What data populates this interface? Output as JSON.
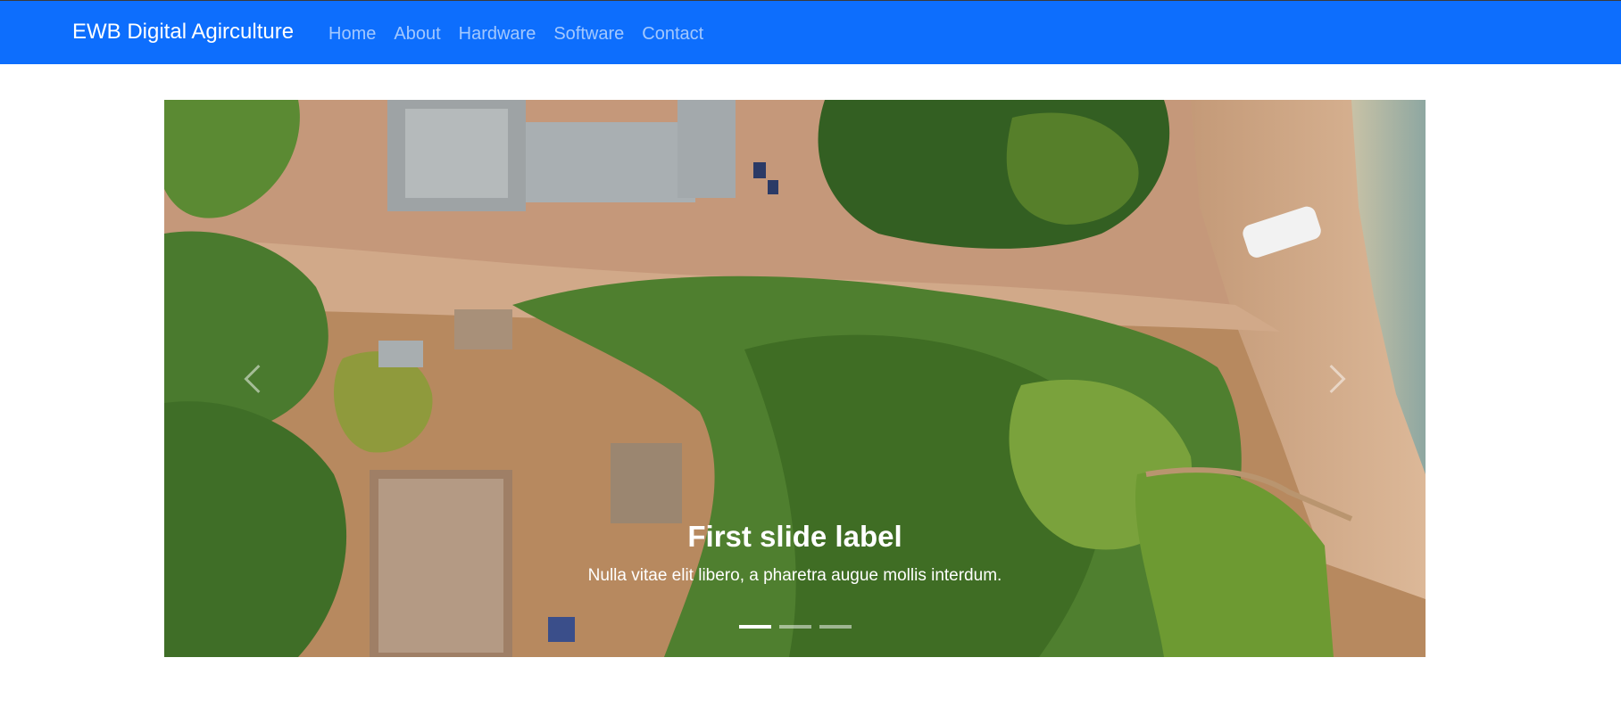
{
  "navbar": {
    "brand": "EWB Digital Agirculture",
    "links": [
      "Home",
      "About",
      "Hardware",
      "Software",
      "Contact"
    ]
  },
  "carousel": {
    "caption": {
      "title": "First slide label",
      "text": "Nulla vitae elit libero, a pharetra augue mollis interdum."
    },
    "slide_count": 3,
    "active_slide": 1,
    "controls": {
      "prev_icon": "chevron-left-icon",
      "next_icon": "chevron-right-icon"
    }
  },
  "colors": {
    "navbar_bg": "#0d6efd",
    "brand_text": "#ffffff",
    "nav_link_text": "rgba(255,255,255,0.62)",
    "page_bg": "#ffffff"
  }
}
